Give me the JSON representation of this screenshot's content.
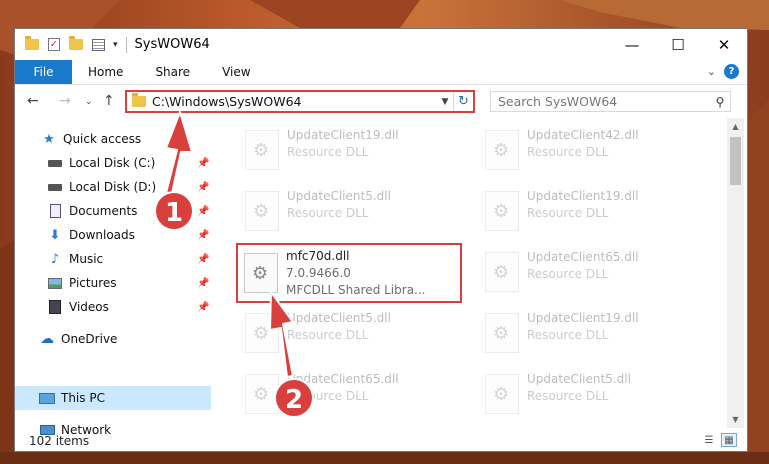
{
  "window": {
    "title": "SysWOW64",
    "controls": {
      "minimize": "—",
      "maximize": "☐",
      "close": "✕"
    }
  },
  "ribbon": {
    "file_tab": "File",
    "tabs": [
      "Home",
      "Share",
      "View"
    ]
  },
  "address": {
    "path": "C:\\Windows\\SysWOW64"
  },
  "search": {
    "placeholder": "Search SysWOW64"
  },
  "nav": {
    "items": [
      {
        "label": "Quick access",
        "icon": "star-icon"
      },
      {
        "label": "Local Disk (C:)",
        "icon": "drive-icon"
      },
      {
        "label": "Local Disk (D:)",
        "icon": "drive-icon"
      },
      {
        "label": "Documents",
        "icon": "documents-icon"
      },
      {
        "label": "Downloads",
        "icon": "download-icon"
      },
      {
        "label": "Music",
        "icon": "music-icon"
      },
      {
        "label": "Pictures",
        "icon": "pictures-icon"
      },
      {
        "label": "Videos",
        "icon": "videos-icon"
      },
      {
        "label": "OneDrive",
        "icon": "cloud-icon"
      },
      {
        "label": "This PC",
        "icon": "computer-icon",
        "selected": true
      },
      {
        "label": "Network",
        "icon": "network-icon"
      }
    ]
  },
  "files": [
    {
      "name": "UpdateClient19.dll",
      "sub": "Resource DLL"
    },
    {
      "name": "UpdateClient42.dll",
      "sub": "Resource DLL"
    },
    {
      "name": "UpdateClient5.dll",
      "sub": "Resource DLL"
    },
    {
      "name": "UpdateClient19.dll",
      "sub": "Resource DLL"
    },
    {
      "name": "mfc70d.dll",
      "version": "7.0.9466.0",
      "sub": "MFCDLL Shared Libra..."
    },
    {
      "name": "UpdateClient65.dll",
      "sub": "Resource DLL"
    },
    {
      "name": "UpdateClient5.dll",
      "sub": "Resource DLL"
    },
    {
      "name": "UpdateClient19.dll",
      "sub": "Resource DLL"
    },
    {
      "name": "UpdateClient65.dll",
      "sub": "Resource DLL"
    },
    {
      "name": "UpdateClient5.dll",
      "sub": "Resource DLL"
    }
  ],
  "status": {
    "item_count": "102 items"
  },
  "annotations": {
    "step1": "1",
    "step2": "2",
    "color": "#d9403b"
  }
}
